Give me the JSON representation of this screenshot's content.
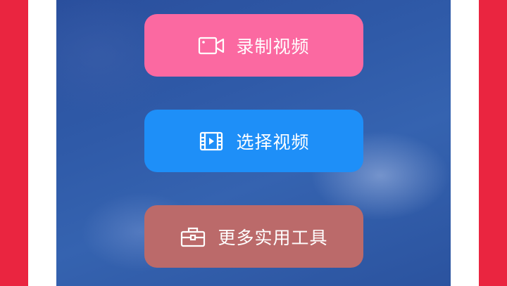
{
  "buttons": {
    "record": {
      "label": "录制视频",
      "icon": "video-camera-icon",
      "color": "#fb69a1"
    },
    "select": {
      "label": "选择视频",
      "icon": "film-icon",
      "color": "#1e8ff8"
    },
    "tools": {
      "label": "更多实用工具",
      "icon": "toolbox-icon",
      "color": "#bb6a6a"
    }
  },
  "colors": {
    "outer_background": "#ea2540",
    "frame": "#ffffff",
    "screen_background": "#2f5aa8"
  }
}
